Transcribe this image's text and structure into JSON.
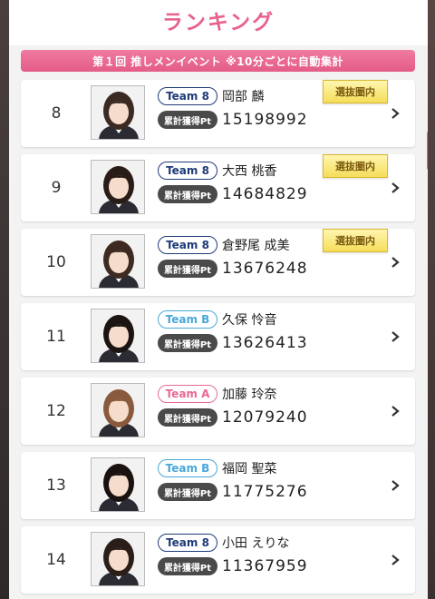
{
  "header": {
    "title": "ランキング"
  },
  "banner": {
    "text": "第１回 推しメンイベント ※10分ごとに自動集計"
  },
  "labels": {
    "pt_label": "累計獲得Pt",
    "badge": "選抜圏内"
  },
  "colors": {
    "accent": "#e8618c",
    "team8": "#1f3b78",
    "teamB": "#4aa8d8",
    "teamA": "#e86a93"
  },
  "rows": [
    {
      "rank": "8",
      "team": "Team 8",
      "name": "岡部 麟",
      "points": "15198992",
      "badge": true,
      "hair": "#3b2a22"
    },
    {
      "rank": "9",
      "team": "Team 8",
      "name": "大西 桃香",
      "points": "14684829",
      "badge": true,
      "hair": "#2a1d18"
    },
    {
      "rank": "10",
      "team": "Team 8",
      "name": "倉野尾 成美",
      "points": "13676248",
      "badge": true,
      "hair": "#3d2a20"
    },
    {
      "rank": "11",
      "team": "Team B",
      "name": "久保 怜音",
      "points": "13626413",
      "badge": false,
      "hair": "#1c1412"
    },
    {
      "rank": "12",
      "team": "Team A",
      "name": "加藤 玲奈",
      "points": "12079240",
      "badge": false,
      "hair": "#8a5a3e"
    },
    {
      "rank": "13",
      "team": "Team B",
      "name": "福岡 聖菜",
      "points": "11775276",
      "badge": false,
      "hair": "#1a1210"
    },
    {
      "rank": "14",
      "team": "Team 8",
      "name": "小田 えりな",
      "points": "11367959",
      "badge": false,
      "hair": "#2b1e18"
    }
  ]
}
